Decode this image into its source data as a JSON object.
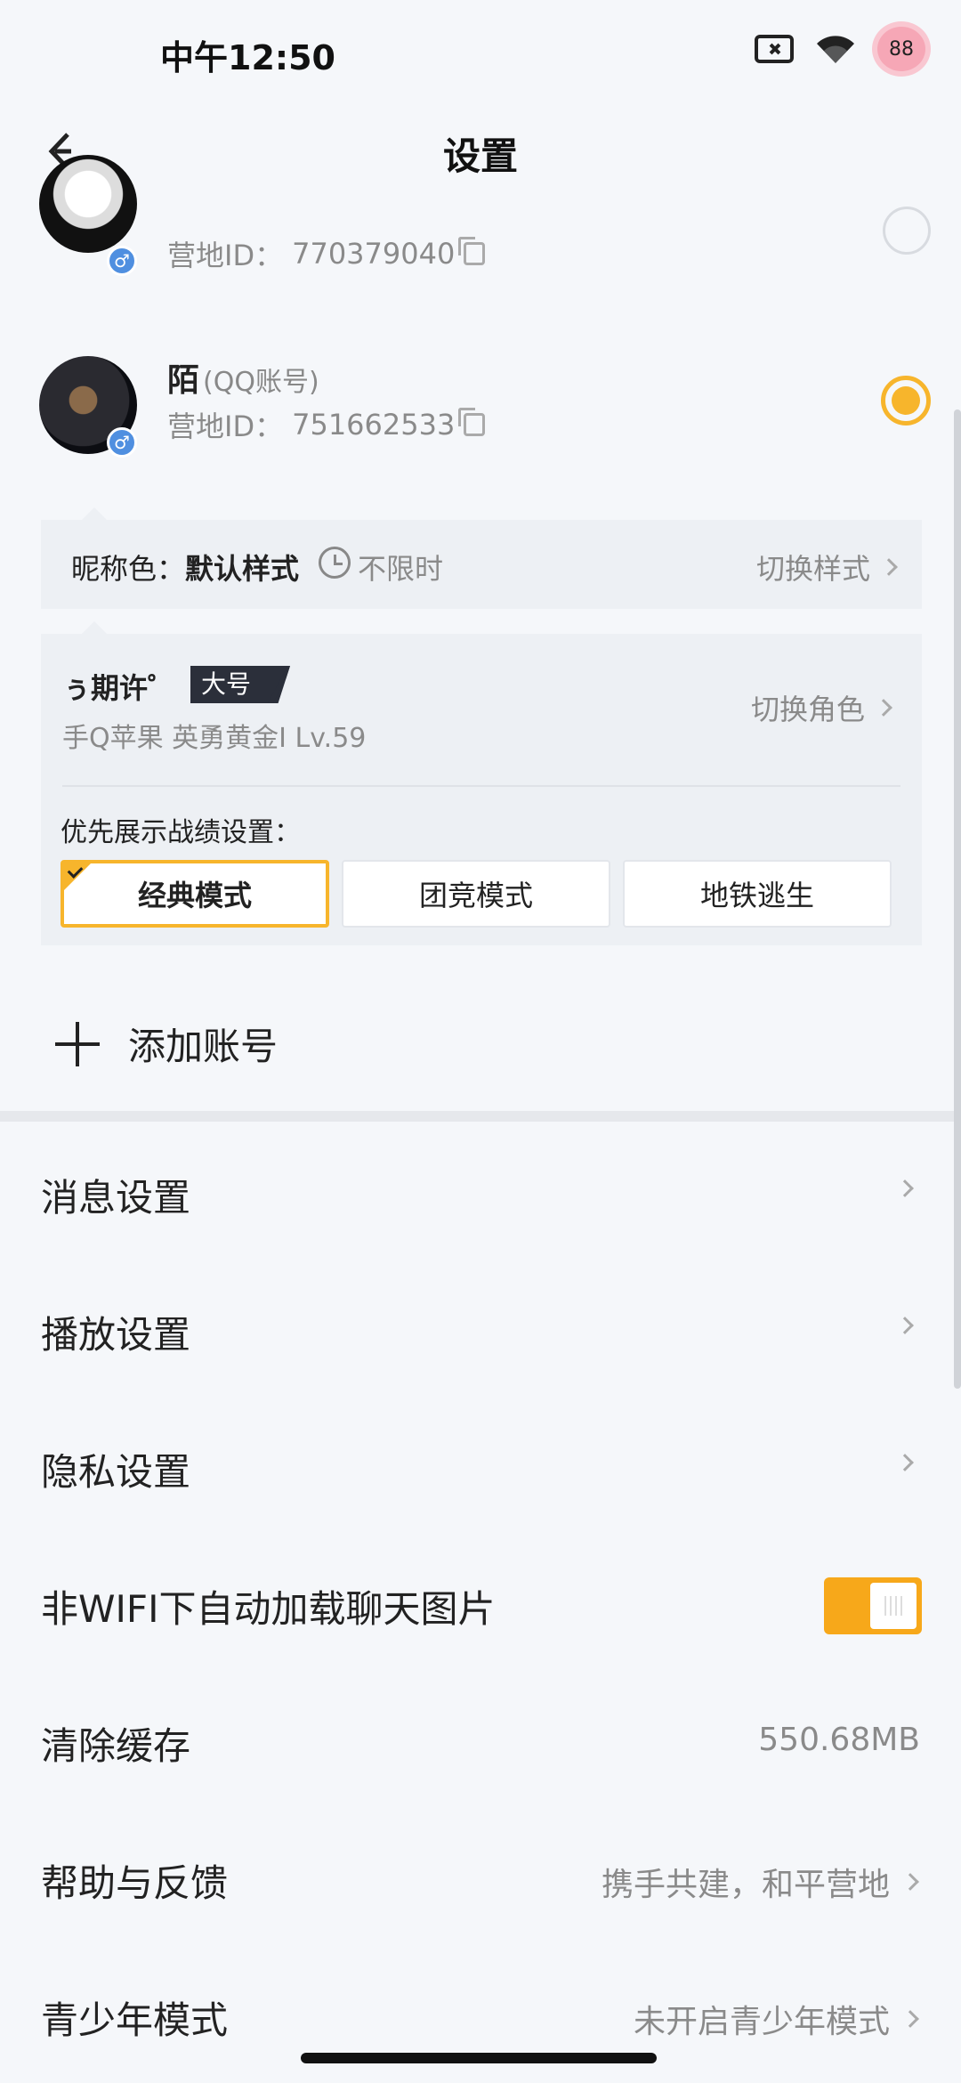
{
  "status_bar": {
    "time": "中午12:50",
    "battery": "88",
    "icons": [
      "sim-off-icon",
      "wifi-icon",
      "battery-badge-icon"
    ]
  },
  "header": {
    "title": "设置",
    "back_icon": "back-arrow-icon"
  },
  "accounts": [
    {
      "name": "",
      "type": "",
      "id_label": "营地ID：",
      "id": "770379040",
      "selected": false
    },
    {
      "name": "陌",
      "type": "(QQ账号)",
      "id_label": "营地ID：",
      "id": "751662533",
      "selected": true
    }
  ],
  "nickname_color": {
    "label": "昵称色：",
    "value": "默认样式",
    "limit": "不限时",
    "switch_label": "切换样式"
  },
  "role": {
    "name": "ぅ期许゜",
    "tag": "大号",
    "meta": "手Q苹果  英勇黄金I  Lv.59",
    "switch_label": "切换角色",
    "priority_label": "优先展示战绩设置：",
    "modes": [
      "经典模式",
      "团竞模式",
      "地铁逃生"
    ],
    "selected_mode": "经典模式"
  },
  "add_account": {
    "label": "添加账号"
  },
  "settings": {
    "message": {
      "label": "消息设置"
    },
    "playback": {
      "label": "播放设置"
    },
    "privacy": {
      "label": "隐私设置"
    },
    "auto_load": {
      "label": "非WIFI下自动加载聊天图片",
      "enabled": true
    },
    "cache": {
      "label": "清除缓存",
      "value": "550.68MB"
    },
    "help": {
      "label": "帮助与反馈",
      "value": "携手共建，和平营地"
    },
    "teen": {
      "label": "青少年模式",
      "value": "未开启青少年模式"
    }
  },
  "colors": {
    "accent": "#f7b52c",
    "toggle_on": "#f7a81a",
    "background": "#f5f7fa",
    "card": "#edf0f4"
  }
}
